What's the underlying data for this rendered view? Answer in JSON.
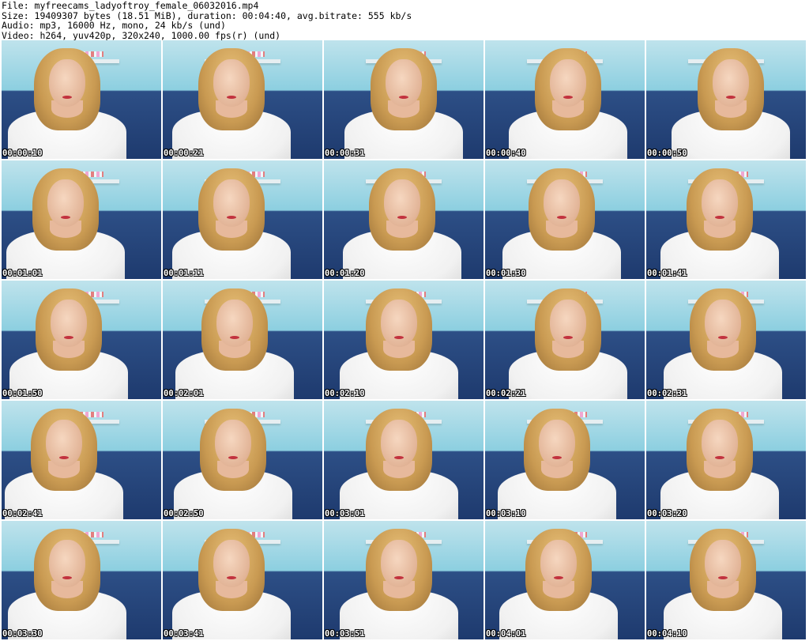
{
  "header": {
    "file_line": "File: myfreecams_ladyoftroy_female_06032016.mp4",
    "size_line": "Size: 19409307 bytes (18.51 MiB), duration: 00:04:40, avg.bitrate: 555 kb/s",
    "audio_line": "Audio: mp3, 16000 Hz, mono, 24 kb/s (und)",
    "video_line": "Video: h264, yuv420p, 320x240, 1000.00 fps(r) (und)"
  },
  "thumbnails": [
    {
      "timestamp": "00:00:10"
    },
    {
      "timestamp": "00:00:21"
    },
    {
      "timestamp": "00:00:31"
    },
    {
      "timestamp": "00:00:40"
    },
    {
      "timestamp": "00:00:50"
    },
    {
      "timestamp": "00:01:01"
    },
    {
      "timestamp": "00:01:11"
    },
    {
      "timestamp": "00:01:20"
    },
    {
      "timestamp": "00:01:30"
    },
    {
      "timestamp": "00:01:41"
    },
    {
      "timestamp": "00:01:50"
    },
    {
      "timestamp": "00:02:01"
    },
    {
      "timestamp": "00:02:10"
    },
    {
      "timestamp": "00:02:21"
    },
    {
      "timestamp": "00:02:31"
    },
    {
      "timestamp": "00:02:41"
    },
    {
      "timestamp": "00:02:50"
    },
    {
      "timestamp": "00:03:01"
    },
    {
      "timestamp": "00:03:10"
    },
    {
      "timestamp": "00:03:20"
    },
    {
      "timestamp": "00:03:30"
    },
    {
      "timestamp": "00:03:41"
    },
    {
      "timestamp": "00:03:51"
    },
    {
      "timestamp": "00:04:01"
    },
    {
      "timestamp": "00:04:10"
    }
  ]
}
